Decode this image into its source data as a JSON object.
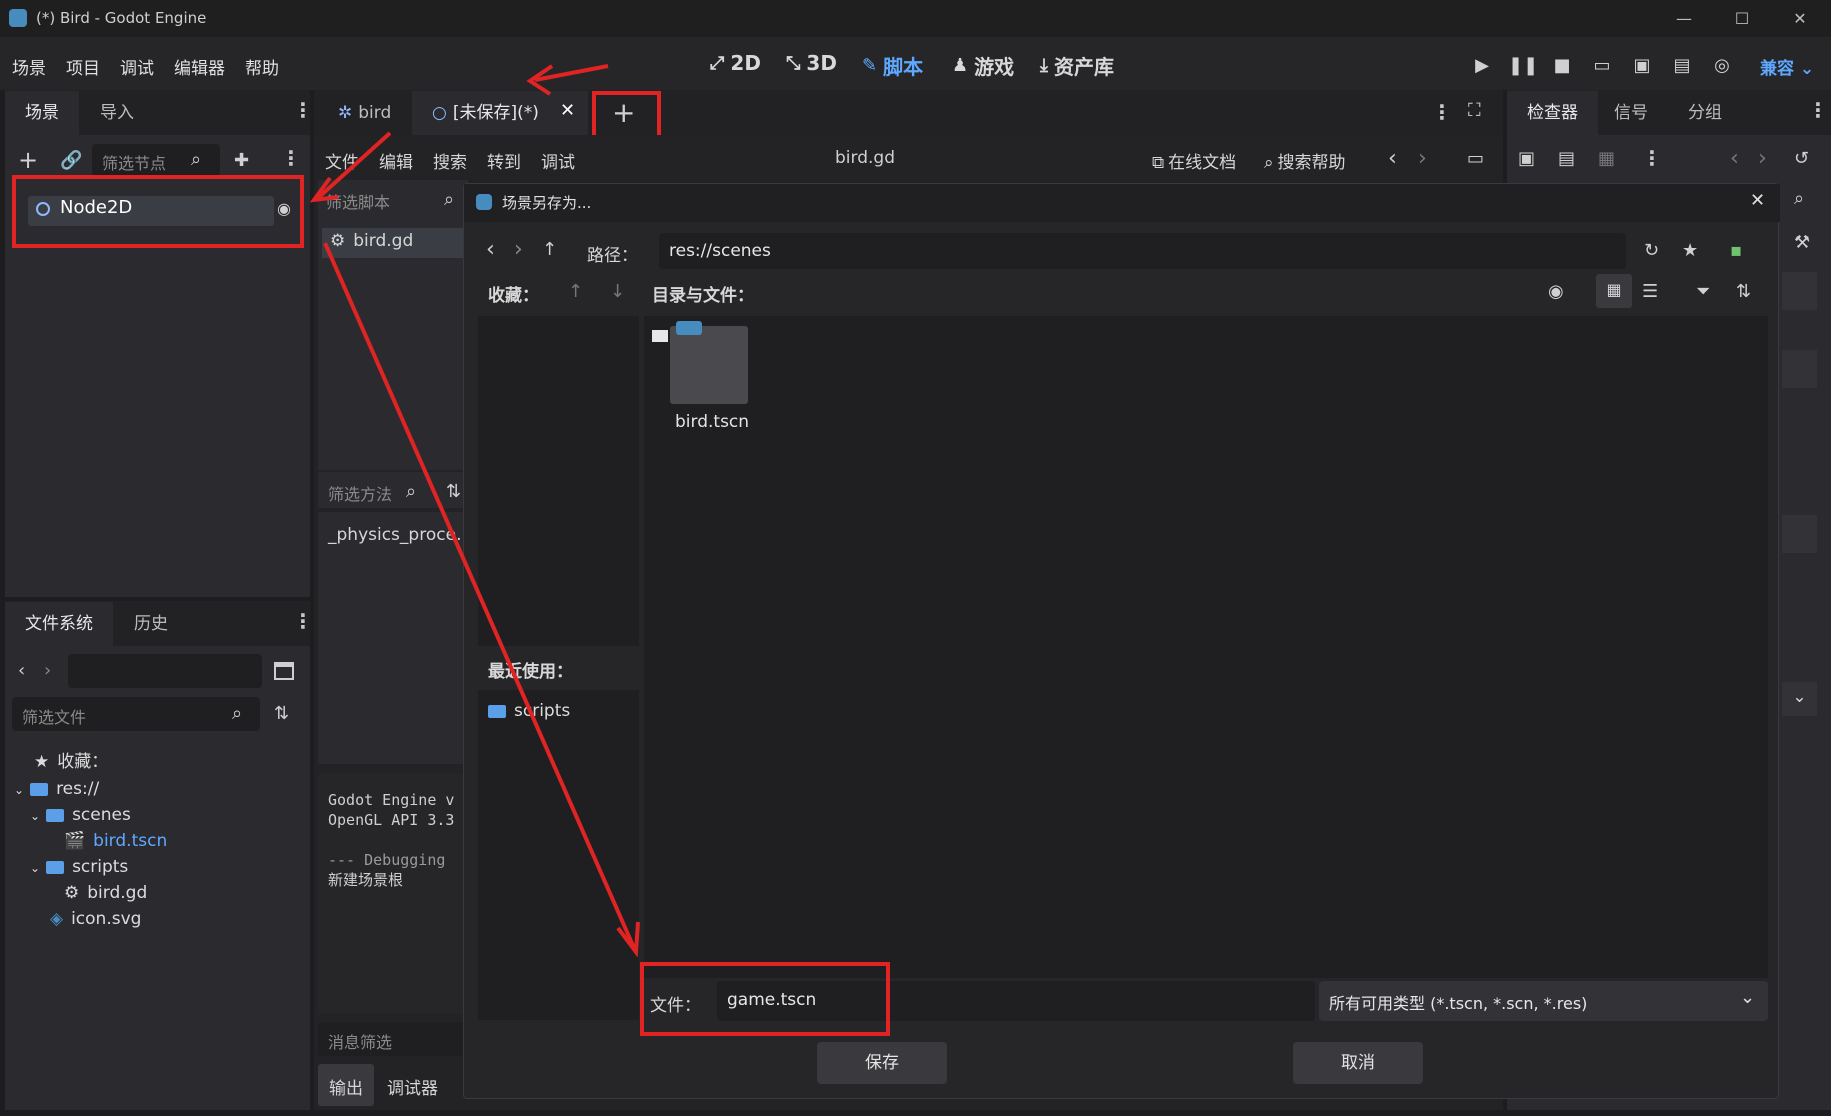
{
  "window": {
    "title": "(*) Bird - Godot Engine"
  },
  "menu": [
    "场景",
    "项目",
    "调试",
    "编辑器",
    "帮助"
  ],
  "modes": [
    {
      "icon": "2d-icon",
      "label": "2D",
      "active": false
    },
    {
      "icon": "3d-icon",
      "label": "3D",
      "active": false
    },
    {
      "icon": "script-icon",
      "label": "脚本",
      "active": true
    },
    {
      "icon": "game-icon",
      "label": "游戏",
      "active": false
    },
    {
      "icon": "assetlib-icon",
      "label": "资产库",
      "active": false
    }
  ],
  "compat": "兼容",
  "scene_dock": {
    "tabs": [
      "场景",
      "导入"
    ],
    "filter_placeholder": "筛选节点",
    "root_node": "Node2D"
  },
  "fs_dock": {
    "tabs": [
      "文件系统",
      "历史"
    ],
    "filter_placeholder": "筛选文件",
    "favorites": "收藏：",
    "tree": [
      {
        "label": "res://",
        "type": "folder",
        "indent": 0
      },
      {
        "label": "scenes",
        "type": "folder",
        "indent": 1
      },
      {
        "label": "bird.tscn",
        "type": "scene",
        "indent": 2,
        "highlight": true
      },
      {
        "label": "scripts",
        "type": "folder",
        "indent": 1
      },
      {
        "label": "bird.gd",
        "type": "script",
        "indent": 2
      },
      {
        "label": "icon.svg",
        "type": "icon",
        "indent": 1
      }
    ]
  },
  "editor_tabs": [
    {
      "label": "bird",
      "active": false
    },
    {
      "label": "[未保存](*)",
      "active": true
    }
  ],
  "script_menu": [
    "文件",
    "编辑",
    "搜索",
    "转到",
    "调试"
  ],
  "script_name": "bird.gd",
  "online_docs": "在线文档",
  "search_help": "搜索帮助",
  "script_filter": "筛选脚本",
  "script_list": [
    "bird.gd"
  ],
  "method_filter": "筛选方法",
  "methods": [
    "_physics_proce…"
  ],
  "output": {
    "lines": [
      "Godot Engine v",
      "OpenGL API 3.3",
      "",
      "--- Debugging ",
      "新建场景根"
    ],
    "filter": "消息筛选",
    "tabs": [
      "输出",
      "调试器"
    ]
  },
  "inspector": {
    "tabs": [
      "检查器",
      "信号",
      "分组"
    ]
  },
  "dialog": {
    "title": "场景另存为...",
    "path_label": "路径：",
    "path_value": "res://scenes",
    "favorites_label": "收藏：",
    "dirs_label": "目录与文件：",
    "recent_label": "最近使用：",
    "recent": [
      "scripts"
    ],
    "files": [
      {
        "name": "bird.tscn"
      }
    ],
    "file_label": "文件：",
    "file_value": "game.tscn",
    "filter_value": "所有可用类型 (*.tscn, *.scn, *.res)",
    "save": "保存",
    "cancel": "取消"
  },
  "colors": {
    "accent": "#5fa8ff",
    "annotation": "#e02424"
  }
}
